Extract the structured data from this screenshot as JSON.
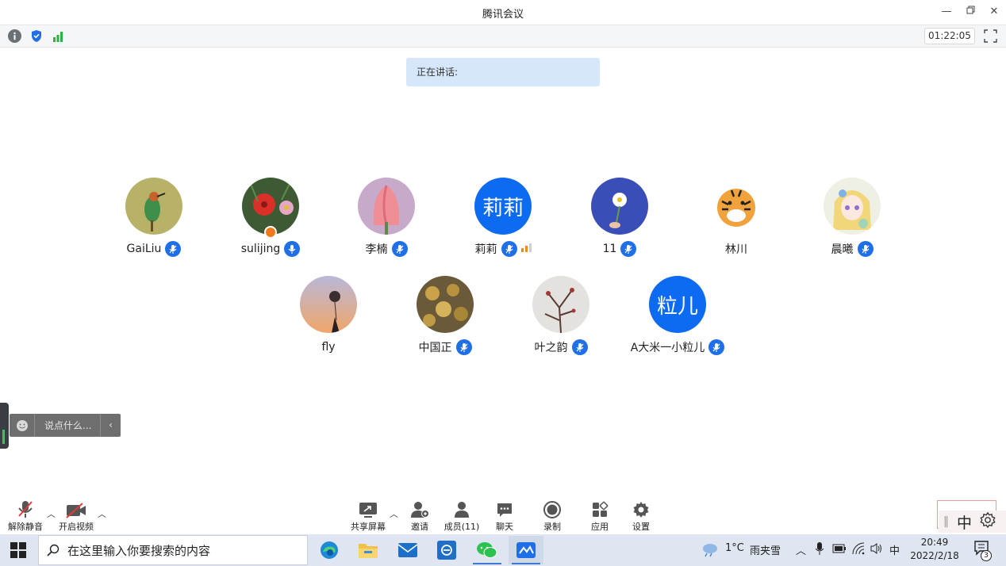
{
  "window": {
    "title": "腾讯会议"
  },
  "infobar": {
    "timer": "01:22:05"
  },
  "speaking": {
    "label": "正在讲话:"
  },
  "participants": [
    {
      "name": "GaiLiu",
      "avatar": "bird-photo"
    },
    {
      "name": "sulijing",
      "avatar": "flowers-photo",
      "host_badge": true
    },
    {
      "name": "李楠",
      "avatar": "tulip-photo"
    },
    {
      "name": "莉莉",
      "avatar_text": "莉莉",
      "signal": true
    },
    {
      "name": "11",
      "avatar": "daisy-photo"
    },
    {
      "name": "林川",
      "avatar": "tiger-drawing",
      "no_mic": true
    },
    {
      "name": "晨曦",
      "avatar": "anime-girl-drawing"
    },
    {
      "name": "fly",
      "avatar": "balloon-photo",
      "no_mic": true
    },
    {
      "name": "中国正",
      "avatar": "gold-coins-photo"
    },
    {
      "name": "叶之韵",
      "avatar": "snow-branches-photo"
    },
    {
      "name": "A大米一小粒儿",
      "avatar_text": "粒儿"
    }
  ],
  "chat": {
    "placeholder": "说点什么..."
  },
  "toolbar": {
    "unmute": "解除静音",
    "video": "开启视频",
    "share": "共享屏幕",
    "invite": "邀请",
    "members": "成员(11)",
    "chat": "聊天",
    "record": "录制",
    "apps": "应用",
    "settings": "设置"
  },
  "ime": {
    "mode": "中"
  },
  "taskbar": {
    "search_placeholder": "在这里输入你要搜索的内容",
    "weather_temp": "1°C",
    "weather_text": "雨夹雪",
    "ime": "中",
    "time": "20:49",
    "date": "2022/2/18",
    "notifications": "3"
  },
  "colors": {
    "accent": "#0d6bf2",
    "mic": "#1f6fe8",
    "speaking_bg": "#d6e6fb"
  }
}
